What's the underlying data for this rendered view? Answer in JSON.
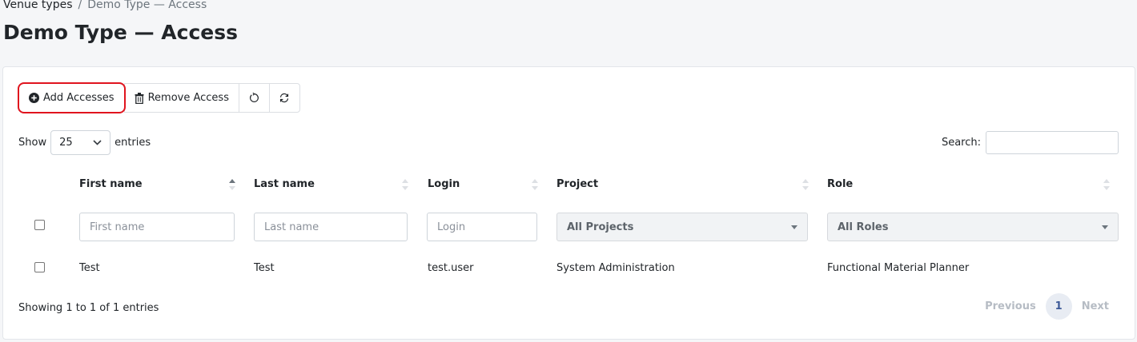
{
  "breadcrumb": {
    "parent": "Venue types",
    "separator": "/",
    "current": "Demo Type — Access"
  },
  "page": {
    "title": "Demo Type — Access"
  },
  "toolbar": {
    "add_label": "Add Accesses",
    "remove_label": "Remove Access",
    "reset_icon": "rotate-ccw-icon",
    "refresh_icon": "refresh-icon",
    "highlight_color": "#e0141e"
  },
  "table_controls": {
    "show_label": "Show",
    "page_length": "25",
    "entries_label": "entries",
    "search_label": "Search:",
    "search_value": ""
  },
  "columns": [
    {
      "label": "First name",
      "sorted": "asc"
    },
    {
      "label": "Last name"
    },
    {
      "label": "Login"
    },
    {
      "label": "Project"
    },
    {
      "label": "Role"
    }
  ],
  "filters": {
    "first_name_placeholder": "First name",
    "last_name_placeholder": "Last name",
    "login_placeholder": "Login",
    "project_selected": "All Projects",
    "role_selected": "All Roles"
  },
  "rows": [
    {
      "first_name": "Test",
      "last_name": "Test",
      "login": "test.user",
      "project": "System Administration",
      "role": "Functional Material Planner"
    }
  ],
  "footer": {
    "info": "Showing 1 to 1 of 1 entries",
    "previous": "Previous",
    "current_page": "1",
    "next": "Next"
  }
}
